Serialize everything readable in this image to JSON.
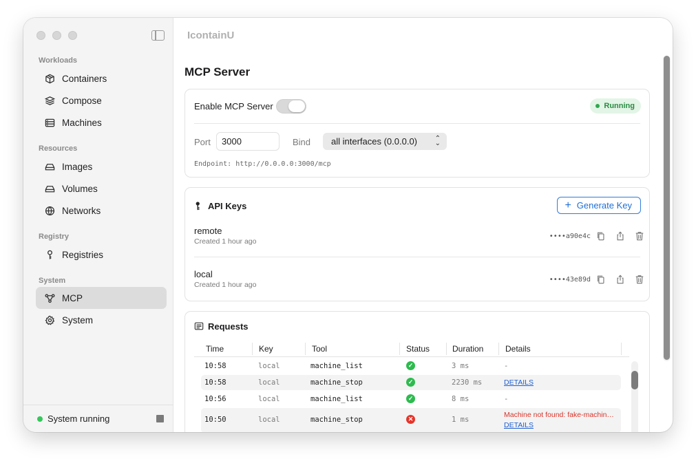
{
  "app": {
    "title": "IcontainU"
  },
  "sidebar": {
    "sections": [
      {
        "label": "Workloads",
        "items": [
          {
            "label": "Containers",
            "icon": "box-icon"
          },
          {
            "label": "Compose",
            "icon": "layers-icon"
          },
          {
            "label": "Machines",
            "icon": "server-icon"
          }
        ]
      },
      {
        "label": "Resources",
        "items": [
          {
            "label": "Images",
            "icon": "drive-icon"
          },
          {
            "label": "Volumes",
            "icon": "drive-icon"
          },
          {
            "label": "Networks",
            "icon": "globe-icon"
          }
        ]
      },
      {
        "label": "Registry",
        "items": [
          {
            "label": "Registries",
            "icon": "key-icon"
          }
        ]
      },
      {
        "label": "System",
        "items": [
          {
            "label": "MCP",
            "icon": "nodes-icon",
            "active": true
          },
          {
            "label": "System",
            "icon": "gear-icon"
          }
        ]
      }
    ],
    "footer": {
      "status": "System running",
      "status_color": "#34c759"
    }
  },
  "page": {
    "title": "MCP Server"
  },
  "server": {
    "enable_label": "Enable MCP Server",
    "status_badge": "Running",
    "port_label": "Port",
    "port_value": "3000",
    "bind_label": "Bind",
    "bind_value": "all interfaces (0.0.0.0)",
    "endpoint": "Endpoint: http://0.0.0.0:3000/mcp"
  },
  "api_keys": {
    "title": "API Keys",
    "generate_label": "Generate Key",
    "keys": [
      {
        "name": "remote",
        "created": "Created 1 hour ago",
        "masked": "••••a90e4c"
      },
      {
        "name": "local",
        "created": "Created 1 hour ago",
        "masked": "••••43e89d"
      }
    ]
  },
  "requests": {
    "title": "Requests",
    "columns": [
      "Time",
      "Key",
      "Tool",
      "Status",
      "Duration",
      "Details"
    ],
    "rows": [
      {
        "time": "10:58",
        "key": "local",
        "tool": "machine_list",
        "status": "ok",
        "duration": "3 ms",
        "details": "-"
      },
      {
        "time": "10:58",
        "key": "local",
        "tool": "machine_stop",
        "status": "ok",
        "duration": "2230 ms",
        "details_link": "DETAILS"
      },
      {
        "time": "10:56",
        "key": "local",
        "tool": "machine_list",
        "status": "ok",
        "duration": "8 ms",
        "details": "-"
      },
      {
        "time": "10:50",
        "key": "local",
        "tool": "machine_stop",
        "status": "error",
        "duration": "1 ms",
        "error": "Machine not found: fake-machin…",
        "details_link": "DETAILS"
      }
    ]
  }
}
